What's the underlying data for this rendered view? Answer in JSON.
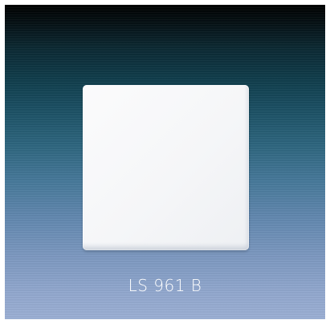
{
  "caption": "LS 961 B",
  "colors": {
    "background_top": "#000000",
    "background_mid": "#2f6780",
    "background_bottom": "#9cb0d5",
    "plate": "#f7f8fa",
    "caption_text": "#ffffff"
  }
}
